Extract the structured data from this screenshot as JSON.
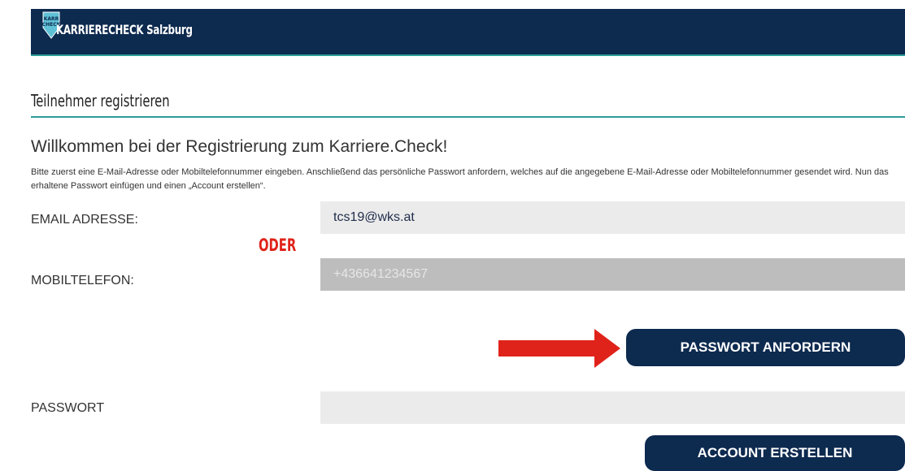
{
  "header": {
    "logo_text": "KARRIERE CHECK",
    "app_title": "KARRIERECHECK Salzburg"
  },
  "page": {
    "section_title": "Teilnehmer registrieren",
    "welcome": "Willkommen bei der Registrierung zum Karriere.Check!",
    "intro": "Bitte zuerst eine E-Mail-Adresse oder Mobiltelefonnummer eingeben. Anschließend das persönliche Passwort anfordern, welches auf die angegebene E-Mail-Adresse oder Mobiltelefonnummer gesendet wird. Nun das erhaltene Passwort einfügen und einen „Account erstellen“."
  },
  "form": {
    "email_label": "EMAIL ADRESSE:",
    "email_value": "tcs19@wks.at",
    "or_annotation": "ODER",
    "mobile_label": "MOBILTELEFON:",
    "mobile_placeholder": "+436641234567",
    "password_label": "PASSWORT",
    "password_value": "",
    "request_password_button": "PASSWORT ANFORDERN",
    "create_account_button": "ACCOUNT ERSTELLEN"
  },
  "colors": {
    "brand_navy": "#0d2a4f",
    "accent_teal": "#2a9d97",
    "annotation_red": "#e0231a"
  },
  "icons": {
    "logo": "karrierecheck-logo-icon",
    "arrow": "red-arrow-right-icon"
  }
}
